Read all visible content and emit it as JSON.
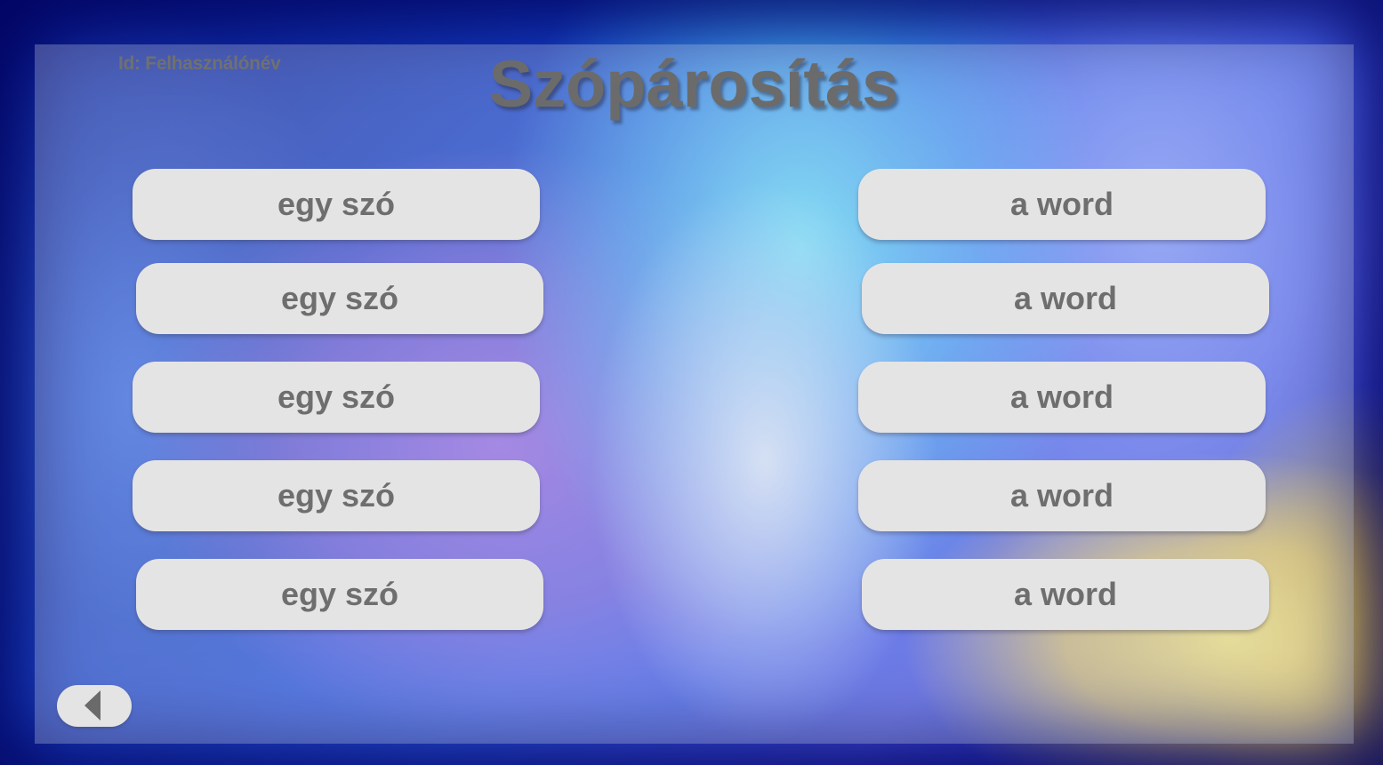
{
  "header": {
    "user_id": "Id: Felhasználónév",
    "title": "Szópárosítás"
  },
  "words": {
    "left": [
      "egy szó",
      "egy szó",
      "egy szó",
      "egy szó",
      "egy szó"
    ],
    "right": [
      "a word",
      "a word",
      "a word",
      "a word",
      "a word"
    ]
  },
  "nav": {
    "back_icon": "triangle-left-icon"
  },
  "colors": {
    "button_fill": "#e4e4e4",
    "button_text": "#6e6e6e",
    "title_text": "#6b6b6b"
  }
}
